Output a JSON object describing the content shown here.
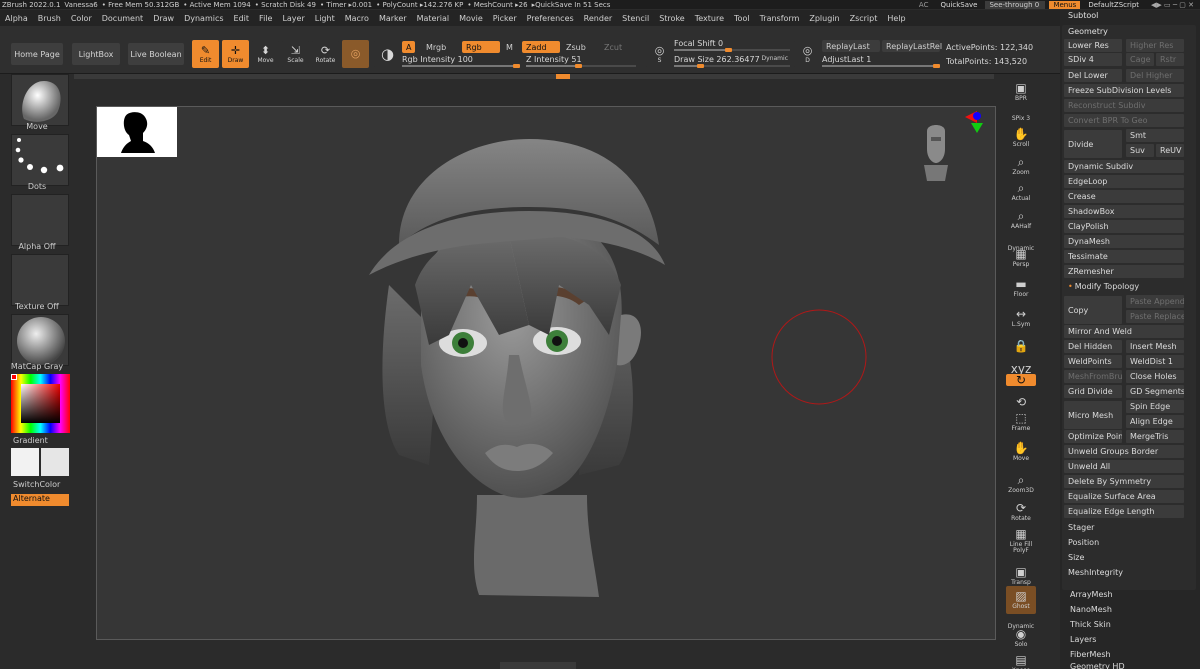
{
  "titlebar": {
    "app": "ZBrush 2022.0.1",
    "doc": "Vanessa6",
    "free_mem": "• Free Mem 50.312GB",
    "active_mem": "• Active Mem 1094",
    "scratch": "• Scratch Disk 49",
    "timer": "• Timer ▸0.001",
    "polycount": "• PolyCount ▸142.276 KP",
    "meshcount": "• MeshCount ▸26",
    "quicksave_in": "▸QuickSave In 51 Secs",
    "ac": "AC",
    "quicksave": "QuickSave",
    "seethrough": "See-through 0",
    "menus": "Menus",
    "script": "DefaultZScript"
  },
  "menubar": [
    "Alpha",
    "Brush",
    "Color",
    "Document",
    "Draw",
    "Dynamics",
    "Edit",
    "File",
    "Layer",
    "Light",
    "Macro",
    "Marker",
    "Material",
    "Movie",
    "Picker",
    "Preferences",
    "Render",
    "Stencil",
    "Stroke",
    "Texture",
    "Tool",
    "Transform",
    "Zplugin",
    "Zscript",
    "Help"
  ],
  "toolbar": {
    "home": "Home Page",
    "lightbox": "LightBox",
    "liveboolean": "Live Boolean",
    "edit": "Edit",
    "draw": "Draw",
    "move": "Move",
    "scale": "Scale",
    "rotate": "Rotate",
    "a": "A",
    "mrgb": "Mrgb",
    "rgb": "Rgb",
    "m": "M",
    "zadd": "Zadd",
    "zsub": "Zsub",
    "zcut": "Zcut",
    "rgb_intensity": "Rgb Intensity 100",
    "z_intensity": "Z Intensity 51",
    "focal_shift": "Focal Shift 0",
    "draw_size": "Draw Size 262.36477",
    "dynamic": "Dynamic",
    "replaylast": "ReplayLast",
    "replaylastrel": "ReplayLastRel",
    "adjustlast": "AdjustLast 1",
    "activepoints": "ActivePoints: 122,340",
    "totalpoints": "TotalPoints: 143,520",
    "s": "S",
    "d": "D"
  },
  "levels": {
    "rgb_intensity": 1.0,
    "z_intensity": 0.51,
    "focal_shift": 0.5,
    "draw_size": 0.26,
    "adjustlast": 1.0
  },
  "leftpanel": {
    "move": "Move",
    "dots": "Dots",
    "alpha": "Alpha Off",
    "texture": "Texture Off",
    "matcap": "MatCap Gray",
    "gradient": "Gradient",
    "switchcolor": "SwitchColor",
    "alternate": "Alternate"
  },
  "rshelf": [
    "BPR",
    "SPix 3",
    "Scroll",
    "Zoom",
    "Actual",
    "AAHalf",
    "Dynamic",
    "Persp",
    "Floor",
    "L.Sym",
    "",
    "XYZ",
    "",
    "",
    "Frame",
    "Move",
    "Zoom3D",
    "Rotate",
    "Line Fill",
    "PolyF",
    "Transp",
    "Ghost",
    "Dynamic",
    "Solo",
    "Xpose"
  ],
  "subtool": {
    "header": "Subtool",
    "geometry": "Geometry",
    "lower_res": "Lower Res",
    "higher_res": "Higher Res",
    "sdiv": "SDiv 4",
    "cage": "Cage",
    "rstr": "Rstr",
    "del_lower": "Del Lower",
    "del_higher": "Del Higher",
    "freeze": "Freeze SubDivision Levels",
    "reconstruct": "Reconstruct Subdiv",
    "convert_bpr": "Convert BPR To Geo",
    "divide": "Divide",
    "smt": "Smt",
    "suv": "Suv",
    "reuv": "ReUV",
    "dynamic_subdiv": "Dynamic Subdiv",
    "edgeloop": "EdgeLoop",
    "crease": "Crease",
    "shadowbox": "ShadowBox",
    "claypolish": "ClayPolish",
    "dynamesh": "DynaMesh",
    "tessimate": "Tessimate",
    "zremesher": "ZRemesher",
    "modify_topology": "Modify Topology",
    "copy": "Copy",
    "paste_append": "Paste Append",
    "paste_replace": "Paste Replace",
    "mirror_weld": "Mirror And Weld",
    "del_hidden": "Del Hidden",
    "insert_mesh": "Insert Mesh",
    "weldpoints": "WeldPoints",
    "welddist": "WeldDist 1",
    "meshfrombrush": "MeshFromBrush",
    "close_holes": "Close Holes",
    "grid_divide": "Grid Divide",
    "gd_segments": "GD Segments 3",
    "micro_mesh": "Micro Mesh",
    "spin_edge": "Spin Edge",
    "align_edge": "Align Edge",
    "optimize_points": "Optimize Points",
    "mergetris": "MergeTris",
    "unweld_groups": "Unweld Groups Border",
    "unweld_all": "Unweld All",
    "delete_symmetry": "Delete By Symmetry",
    "equalize_surface": "Equalize Surface Area",
    "equalize_edge": "Equalize Edge Length",
    "stager": "Stager",
    "position": "Position",
    "size": "Size",
    "meshintegrity": "MeshIntegrity",
    "arraymesh": "ArrayMesh",
    "nanomesh": "NanoMesh",
    "thickskin": "Thick Skin",
    "layers": "Layers",
    "fibermesh": "FiberMesh",
    "geometryhd": "Geometry HD"
  }
}
